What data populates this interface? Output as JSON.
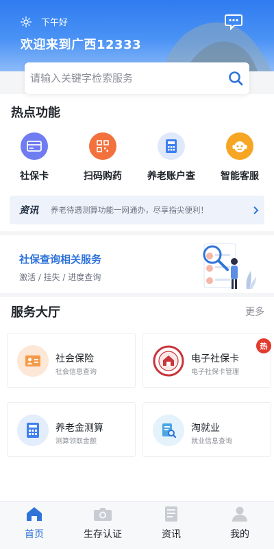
{
  "header": {
    "greeting": "下午好",
    "welcome": "欢迎来到广西12333",
    "sun_icon": "sun-icon",
    "message_icon": "chat-message-icon"
  },
  "search": {
    "placeholder": "请输入关键字检索服务",
    "icon": "search-icon"
  },
  "hot": {
    "title": "热点功能",
    "items": [
      {
        "label": "社保卡",
        "icon": "social-card-icon",
        "color": "#6f7cf2"
      },
      {
        "label": "扫码购药",
        "icon": "qr-code-icon",
        "color": "#f2713d"
      },
      {
        "label": "养老账户查",
        "icon": "calculator-icon",
        "color": "#3f7ff0"
      },
      {
        "label": "智能客服",
        "icon": "robot-service-icon",
        "color": "#f6a623"
      }
    ]
  },
  "news": {
    "tag": "资讯",
    "text": "养老待遇测算功能一网通办，尽享指尖便利！",
    "arrow_icon": "chevron-right-icon"
  },
  "banner": {
    "title": "社保查询相关服务",
    "subtitle": "激活 / 挂失 / 进度查询"
  },
  "hall": {
    "title": "服务大厅",
    "more": "更多",
    "badge": "热",
    "cards": [
      {
        "title": "社会保险",
        "sub": "社会信息查询",
        "icon": "id-card-icon"
      },
      {
        "title": "电子社保卡",
        "sub": "电子社保卡管理",
        "icon": "social-security-seal-icon"
      },
      {
        "title": "养老金测算",
        "sub": "测算领取金额",
        "icon": "calculator-icon"
      },
      {
        "title": "淘就业",
        "sub": "就业信息查询",
        "icon": "document-search-icon"
      }
    ]
  },
  "tabs": [
    {
      "label": "首页",
      "icon": "home-icon",
      "active": true
    },
    {
      "label": "生存认证",
      "icon": "camera-icon",
      "active": false
    },
    {
      "label": "资讯",
      "icon": "news-doc-icon",
      "active": false
    },
    {
      "label": "我的",
      "icon": "user-icon",
      "active": false
    }
  ],
  "colors": {
    "brand_blue": "#2f73d9",
    "hot_badge": "#e23b2e"
  }
}
